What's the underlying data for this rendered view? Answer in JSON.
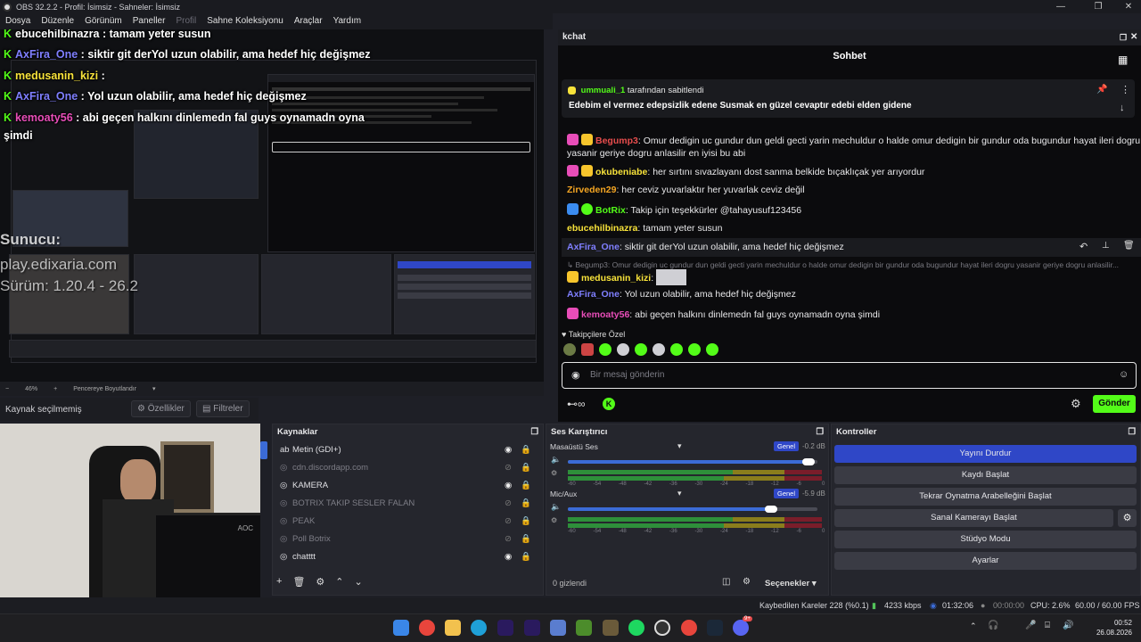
{
  "window": {
    "title": "OBS 32.2.2 - Profil: İsimsiz - Sahneler: İsimsiz"
  },
  "menu": [
    "Dosya",
    "Düzenle",
    "Görünüm",
    "Paneller",
    "Profil",
    "Sahne Koleksiyonu",
    "Araçlar",
    "Yardım"
  ],
  "overlay": {
    "lines": [
      {
        "user": "ebucehilbinazra",
        "sep": " : ",
        "text": "tamam yeter susun"
      },
      {
        "user": "AxFira_One",
        "sep": " : ",
        "text": "siktir git derYol uzun olabilir, ama hedef hiç değişmez"
      },
      {
        "user": "medusanin_kizi",
        "sep": " : ",
        "text": ""
      },
      {
        "user": "AxFira_One",
        "sep": " : ",
        "text": "Yol uzun olabilir, ama hedef hiç değişmez"
      },
      {
        "user": "kemoaty56",
        "sep": " : ",
        "text": "abi geçen halkını dinlemedn fal guys oynamadn oyna"
      },
      {
        "user": "",
        "sep": "",
        "text": "şimdi"
      }
    ],
    "host_label": "Sunucu:",
    "host_url": "play.edixaria.com",
    "version": "Sürüm: 1.20.4 - 26.2"
  },
  "preview_bar": {
    "zoom": "46%",
    "fit": "Pencereye Boyutlandır"
  },
  "source_info": {
    "none_selected": "Kaynak seçilmemiş",
    "properties": "Özellikler",
    "filters": "Filtreler"
  },
  "kchat": {
    "dock_title": "kchat",
    "chat_title": "Sohbet",
    "pinned_by": "ummuali_1",
    "pinned_suffix": "tarafından sabitlendi",
    "pinned_text": "Edebim el vermez edepsizlik edene Susmak en güzel cevaptır edebi elden gidene",
    "messages": [
      {
        "user": "Begump3",
        "color": "#e84d4d",
        "text": "Omur dedigin uc gundur dun geldi gecti yarin mechuldur o halde omur dedigin bir gundur oda bugundur hayat ileri dogru"
      },
      {
        "user": "",
        "color": "",
        "text": "yasanir geriye dogru anlasilir en iyisi bu abi"
      },
      {
        "user": "okubeniabe",
        "color": "#f7e23a",
        "text": "her sırtını sıvazlayanı dost sanma belkide bıçaklıçak yer arıyordur"
      },
      {
        "user": "Zirveden29",
        "color": "#f5a623",
        "text": "her ceviz yuvarlaktır her yuvarlak ceviz değil"
      },
      {
        "user": "BotRix",
        "color": "#53fc18",
        "text": "Takip için teşekkürler @tahayusuf123456"
      },
      {
        "user": "ebucehilbinazra",
        "color": "#f7e23a",
        "text": "tamam yeter susun"
      },
      {
        "user": "AxFira_One",
        "color": "#7f7fff",
        "text": "siktir git derYol uzun olabilir, ama hedef hiç değişmez"
      },
      {
        "user": "",
        "color": "",
        "text": "↳ Begump3: Omur dedigin uc gundur dun geldi gecti yarin mechuldur o halde omur dedigin bir gundur oda bugundur hayat ileri dogru yasanir geriye dogru anlasilir..."
      },
      {
        "user": "medusanin_kizi",
        "color": "#f7e23a",
        "text": ""
      },
      {
        "user": "AxFira_One",
        "color": "#7f7fff",
        "text": "Yol uzun olabilir, ama hedef hiç değişmez"
      },
      {
        "user": "kemoaty56",
        "color": "#e84db8",
        "text": "abi geçen halkını dinlemedn fal guys oynamadn oyna şimdi"
      }
    ],
    "followers_label": "Takipçilere Özel",
    "input_placeholder": "Bir mesaj gönderin",
    "send_label": "Gönder"
  },
  "sources": {
    "title": "Kaynaklar",
    "items": [
      {
        "name": "Metin (GDI+)",
        "visible": true
      },
      {
        "name": "cdn.discordapp.com",
        "visible": false
      },
      {
        "name": "KAMERA",
        "visible": true
      },
      {
        "name": "BOTRIX TAKIP SESLER FALAN",
        "visible": false
      },
      {
        "name": "PEAK",
        "visible": false
      },
      {
        "name": "Poll Botrix",
        "visible": false
      },
      {
        "name": "chatttt",
        "visible": true
      }
    ]
  },
  "mixer": {
    "title": "Ses Karıştırıcı",
    "channels": [
      {
        "name": "Masaüstü Ses",
        "mode": "Genel",
        "db": "-0.2 dB",
        "level": 0.98
      },
      {
        "name": "Mic/Aux",
        "mode": "Genel",
        "db": "-5.9 dB",
        "level": 0.83
      }
    ],
    "scale": [
      "-60",
      "-54",
      "-48",
      "-42",
      "-36",
      "-30",
      "-24",
      "-18",
      "-12",
      "-6",
      "0"
    ],
    "hidden": "0 gizlendi",
    "options": "Seçenekler"
  },
  "controls": {
    "title": "Kontroller",
    "buttons": [
      "Yayını Durdur",
      "Kaydı Başlat",
      "Tekrar Oynatma Arabelleğini Başlat",
      "Sanal Kamerayı Başlat",
      "Stüdyo Modu",
      "Ayarlar"
    ],
    "accent": "#2f47c7"
  },
  "status": {
    "dropped": "Kaybedilen Kareler 228 (%0.1)",
    "bitrate": "4233 kbps",
    "stream_time": "01:32:06",
    "rec_time": "00:00:00",
    "cpu": "CPU: 2.6%",
    "fps": "60.00 / 60.00 FPS"
  },
  "clock": {
    "time": "00:52",
    "date": "26.08.2026"
  },
  "taskbar_badge": "9+"
}
